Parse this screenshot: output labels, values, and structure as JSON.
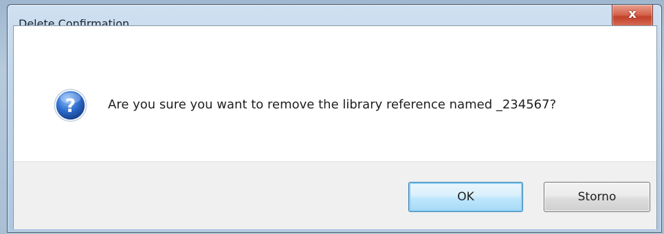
{
  "dialog": {
    "title": "Delete Confirmation",
    "close_symbol": "x",
    "icon": "question-icon",
    "message": "Are you sure you want to remove the library reference named _234567?",
    "buttons": {
      "ok_label": "OK",
      "cancel_label": "Storno"
    }
  },
  "colors": {
    "close_button": "#c94f3a",
    "ok_button_border": "#3c7fb1",
    "button_bar": "#f0f0f0",
    "question_icon": "#2a5fb5"
  }
}
